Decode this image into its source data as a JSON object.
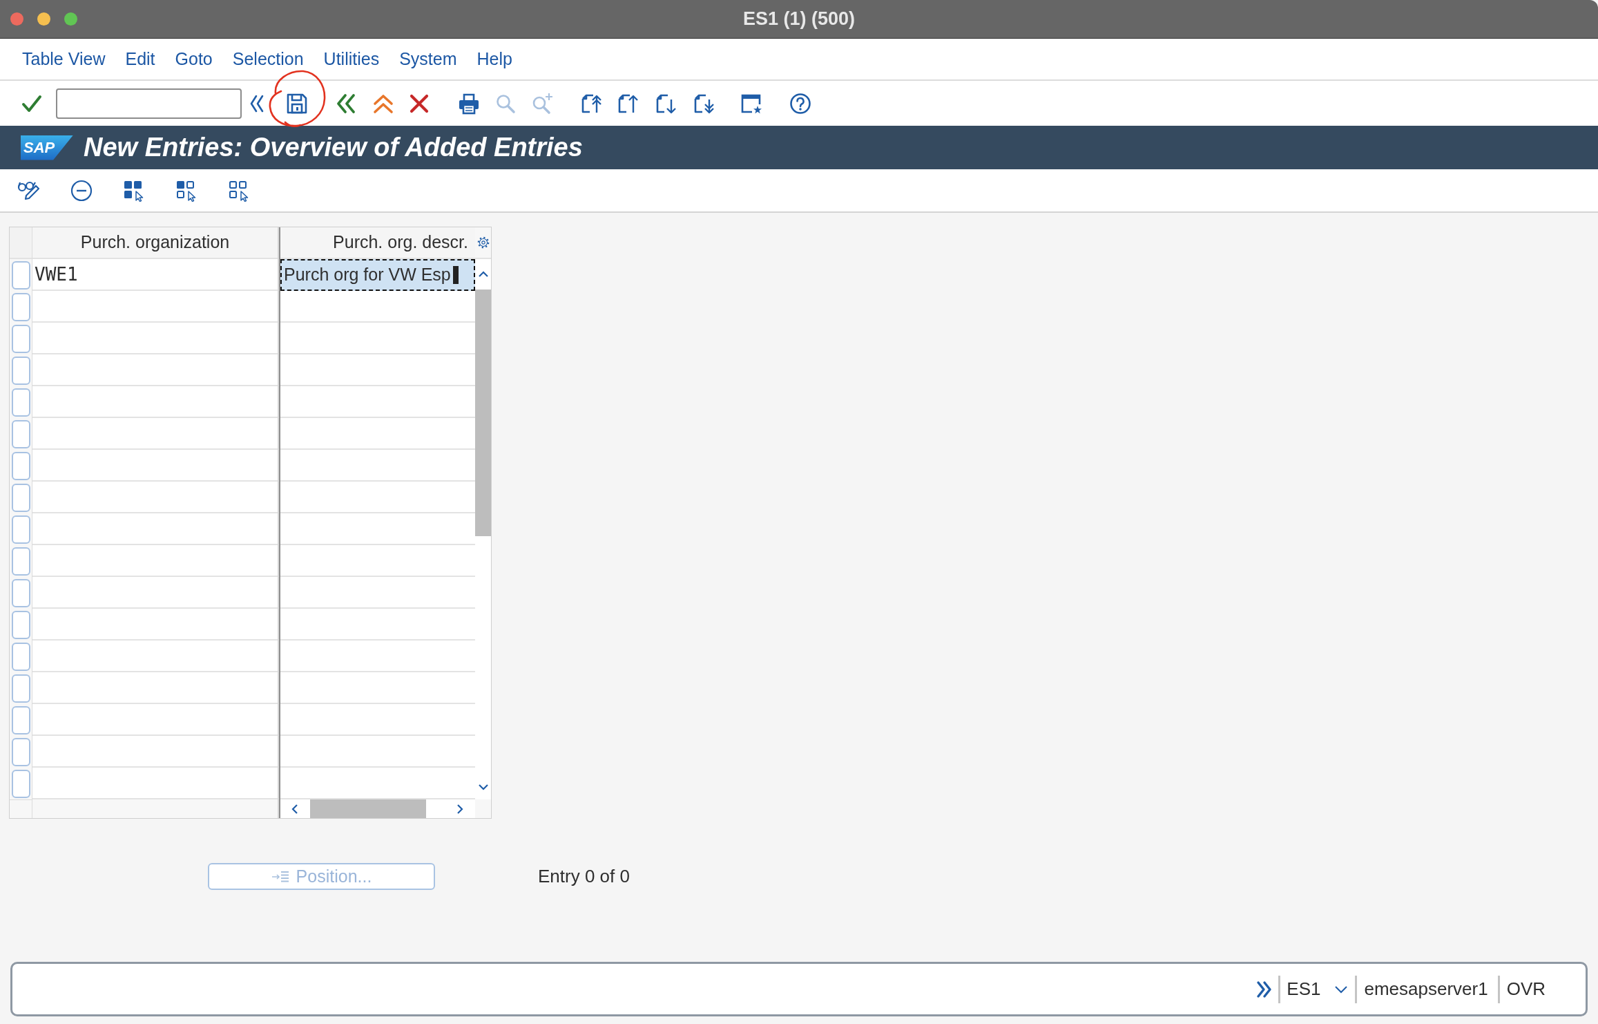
{
  "window": {
    "title": "ES1 (1) (500)"
  },
  "menu": [
    "Table View",
    "Edit",
    "Goto",
    "Selection",
    "Utilities",
    "System",
    "Help"
  ],
  "toolbar": {
    "buttons": [
      {
        "kind": "enter",
        "disabled": false,
        "circled": false
      },
      {
        "kind": "command_field",
        "disabled": false,
        "circled": false
      },
      {
        "kind": "toggle_command_field",
        "disabled": false,
        "circled": false
      },
      {
        "kind": "save",
        "disabled": false,
        "circled": true
      },
      {
        "kind": "back",
        "disabled": false,
        "circled": false
      },
      {
        "kind": "exit",
        "disabled": false,
        "circled": false
      },
      {
        "kind": "cancel",
        "disabled": false,
        "circled": false
      },
      {
        "kind": "print",
        "disabled": false,
        "circled": false
      },
      {
        "kind": "find",
        "disabled": true,
        "circled": false
      },
      {
        "kind": "find_next",
        "disabled": true,
        "circled": false
      },
      {
        "kind": "first_page",
        "disabled": false,
        "circled": false
      },
      {
        "kind": "previous_page",
        "disabled": false,
        "circled": false
      },
      {
        "kind": "next_page",
        "disabled": false,
        "circled": false
      },
      {
        "kind": "last_page",
        "disabled": false,
        "circled": false
      },
      {
        "kind": "new_session",
        "disabled": false,
        "circled": false
      },
      {
        "kind": "help",
        "disabled": false,
        "circled": false
      }
    ]
  },
  "title_bar": {
    "logo": "SAP",
    "title": "New Entries: Overview of Added Entries"
  },
  "application_toolbar": [
    {
      "kind": "display_change"
    },
    {
      "kind": "delete"
    },
    {
      "kind": "select_all"
    },
    {
      "kind": "select_block"
    },
    {
      "kind": "deselect_all"
    }
  ],
  "table": {
    "columns": [
      "Purch. organization",
      "Purch. org. descr."
    ],
    "rows": [
      {
        "selected": false,
        "cells": [
          {
            "value": "VWE1",
            "focused": false
          },
          {
            "value": "Purch org for VW Esp",
            "focused": true
          }
        ]
      },
      {
        "selected": false,
        "cells": [
          {
            "focused": false
          },
          {
            "focused": false
          }
        ]
      },
      {
        "selected": false,
        "cells": [
          {
            "focused": false
          },
          {
            "focused": false
          }
        ]
      },
      {
        "selected": false,
        "cells": [
          {
            "focused": false
          },
          {
            "focused": false
          }
        ]
      },
      {
        "selected": false,
        "cells": [
          {
            "focused": false
          },
          {
            "focused": false
          }
        ]
      },
      {
        "selected": false,
        "cells": [
          {
            "focused": false
          },
          {
            "focused": false
          }
        ]
      },
      {
        "selected": false,
        "cells": [
          {
            "focused": false
          },
          {
            "focused": false
          }
        ]
      },
      {
        "selected": false,
        "cells": [
          {
            "focused": false
          },
          {
            "focused": false
          }
        ]
      },
      {
        "selected": false,
        "cells": [
          {
            "focused": false
          },
          {
            "focused": false
          }
        ]
      },
      {
        "selected": false,
        "cells": [
          {
            "focused": false
          },
          {
            "focused": false
          }
        ]
      },
      {
        "selected": false,
        "cells": [
          {
            "focused": false
          },
          {
            "focused": false
          }
        ]
      },
      {
        "selected": false,
        "cells": [
          {
            "focused": false
          },
          {
            "focused": false
          }
        ]
      },
      {
        "selected": false,
        "cells": [
          {
            "focused": false
          },
          {
            "focused": false
          }
        ]
      },
      {
        "selected": false,
        "cells": [
          {
            "focused": false
          },
          {
            "focused": false
          }
        ]
      },
      {
        "selected": false,
        "cells": [
          {
            "focused": false
          },
          {
            "focused": false
          }
        ]
      },
      {
        "selected": false,
        "cells": [
          {
            "focused": false
          },
          {
            "focused": false
          }
        ]
      },
      {
        "selected": false,
        "cells": [
          {
            "focused": false
          },
          {
            "focused": false
          }
        ]
      }
    ]
  },
  "position_button": {
    "label": "Position...",
    "disabled": true
  },
  "entry_info": "Entry 0 of 0",
  "status_bar": {
    "system": "ES1",
    "server": "emesapserver1",
    "mode": "OVR"
  }
}
